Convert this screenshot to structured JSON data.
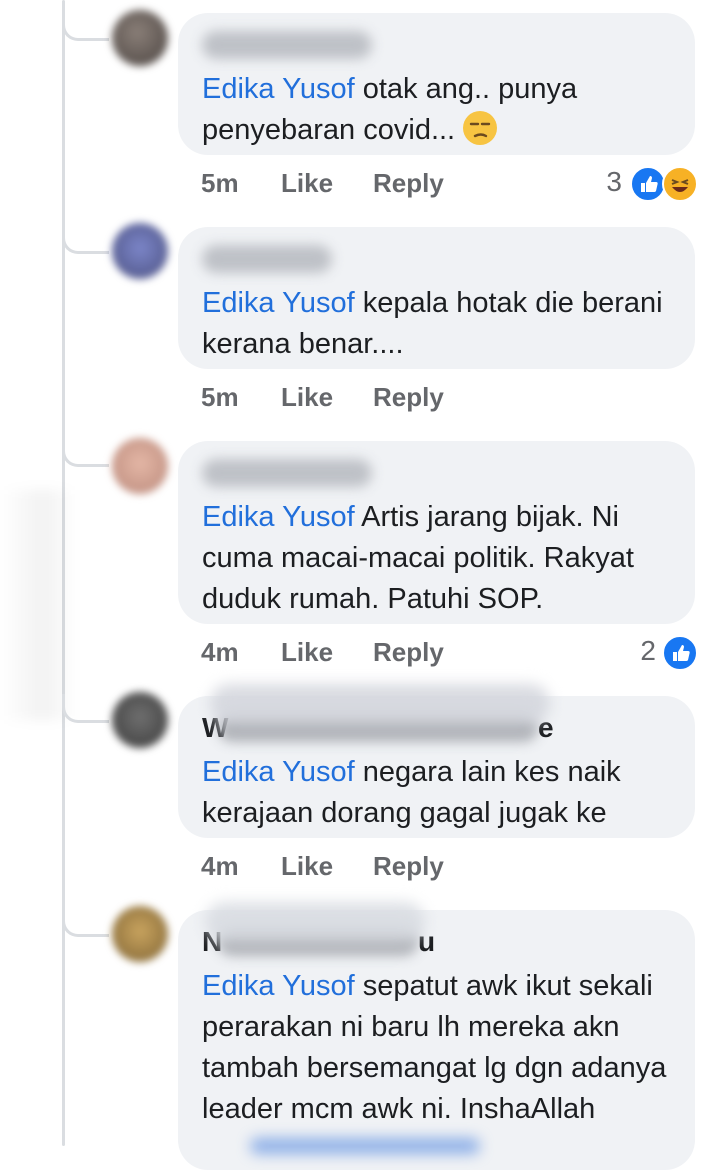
{
  "comments": [
    {
      "mention": "Edika Yusof",
      "text": " otak ang.. punya penyebaran covid... ",
      "time": "5m",
      "like_label": "Like",
      "reply_label": "Reply",
      "reaction_count": "3",
      "reactions": [
        "like-icon",
        "haha-icon"
      ],
      "inline_emoji": "unamused-face-emoji"
    },
    {
      "mention": "Edika Yusof",
      "text": " kepala hotak die berani kerana benar....",
      "time": "5m",
      "like_label": "Like",
      "reply_label": "Reply"
    },
    {
      "mention": "Edika Yusof",
      "text": " Artis jarang bijak. Ni cuma macai-macai politik. Rakyat duduk rumah. Patuhi SOP.",
      "time": "4m",
      "like_label": "Like",
      "reply_label": "Reply",
      "reaction_count": "2",
      "reactions": [
        "like-icon"
      ]
    },
    {
      "name_first": "W",
      "name_last": "e",
      "mention": "Edika Yusof",
      "text": " negara lain kes naik kerajaan dorang gagal jugak ke",
      "time": "4m",
      "like_label": "Like",
      "reply_label": "Reply"
    },
    {
      "name_first": "N",
      "name_last": "u",
      "mention": "Edika Yusof",
      "text": " sepatut awk ikut sekali perarakan ni baru lh mereka akn tambah bersemangat lg dgn adanya leader mcm awk ni. InshaAllah"
    }
  ],
  "colors": {
    "bubble": "#f0f2f5",
    "mention": "#216fdb",
    "meta": "#65676b",
    "thread_line": "#dadde1"
  }
}
